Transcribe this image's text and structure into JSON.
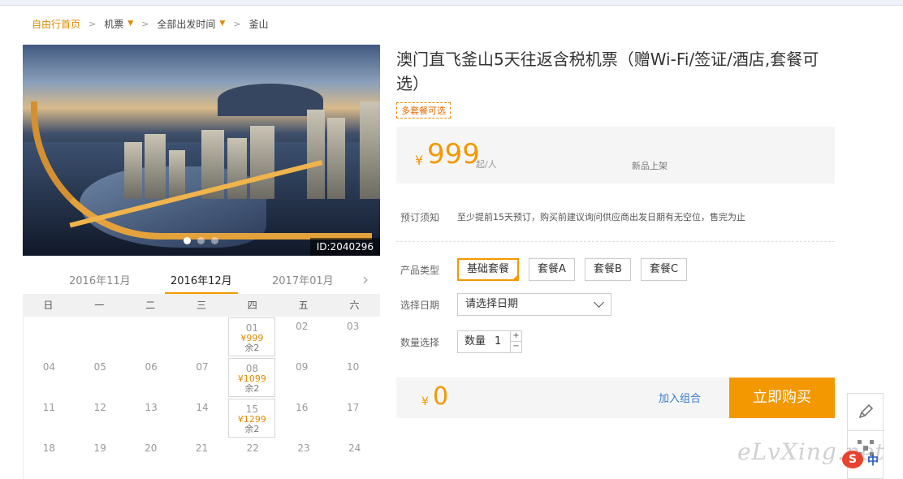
{
  "breadcrumb": {
    "home": "自由行首页",
    "cat": "机票",
    "time": "全部出发时间",
    "dest": "釜山"
  },
  "photo": {
    "id_label": "ID:2040296"
  },
  "calendar": {
    "months": [
      "2016年11月",
      "2016年12月",
      "2017年01月"
    ],
    "active_month": "2016年12月",
    "weekdays": [
      "日",
      "一",
      "二",
      "三",
      "四",
      "五",
      "六"
    ],
    "rows": [
      [
        "",
        "",
        "",
        "",
        "01",
        "02",
        "03"
      ],
      [
        "04",
        "05",
        "06",
        "07",
        "08",
        "09",
        "10"
      ],
      [
        "11",
        "12",
        "13",
        "14",
        "15",
        "16",
        "17"
      ],
      [
        "18",
        "19",
        "20",
        "21",
        "22",
        "23",
        "24"
      ]
    ],
    "avail": {
      "01": {
        "price": "¥999",
        "remain": "余2"
      },
      "08": {
        "price": "¥1099",
        "remain": "余2"
      },
      "15": {
        "price": "¥1299",
        "remain": "余2"
      }
    }
  },
  "product": {
    "title": "澳门直飞釜山5天往返含税机票（赠Wi-Fi/签证/酒店,套餐可选）",
    "tag": "多套餐可选",
    "yen": "¥",
    "price": "999",
    "per": "起/人",
    "new": "新品上架"
  },
  "booking": {
    "notice_label": "预订须知",
    "notice_text": "至少提前15天预订，购买前建议询问供应商出发日期有无空位，售完为止",
    "pkg_label": "产品类型",
    "packages": [
      "基础套餐",
      "套餐A",
      "套餐B",
      "套餐C"
    ],
    "date_label": "选择日期",
    "date_placeholder": "请选择日期",
    "qty_label": "数量选择",
    "qty_text": "数量",
    "qty_value": "1",
    "plus": "+",
    "minus": "−"
  },
  "buy": {
    "yen": "¥",
    "total": "0",
    "add_combo": "加入组合",
    "buy_now": "立即购买"
  },
  "watermark": "eLvXing.net",
  "ime": {
    "s": "S",
    "zh": "中"
  }
}
